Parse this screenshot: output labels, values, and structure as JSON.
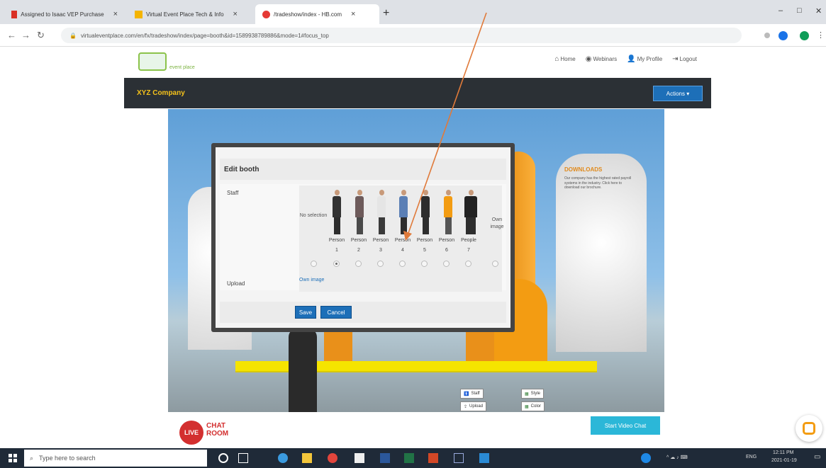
{
  "browser": {
    "tabs": [
      {
        "title": "Assigned to Isaac VEP Purchase",
        "favicon_color": "#d93025"
      },
      {
        "title": "Virtual Event Place Tech & Info",
        "favicon_color": "#f4b400"
      },
      {
        "title": "/tradeshow/index - HB.com",
        "favicon_color": "#e53935",
        "active": true
      }
    ],
    "url": "virtualeventplace.com/en/fx/tradeshow/index/page=booth&id=1589938789886&mode=1#focus_top"
  },
  "site": {
    "nav": [
      {
        "label": "Home",
        "icon": "home-icon"
      },
      {
        "label": "Webinars",
        "icon": "webinar-icon"
      },
      {
        "label": "My Profile",
        "icon": "profile-icon"
      },
      {
        "label": "Logout",
        "icon": "logout-icon"
      }
    ],
    "logo_text": "event place",
    "company": "XYZ Company",
    "actions_label": "Actions"
  },
  "booth": {
    "downloads_title": "DOWNLOADS",
    "downloads_text": "Our company has the highest rated payroll systems in the industry. Click here to download our brochure.",
    "kiosk_buttons": [
      "Staff",
      "Style",
      "Upload",
      "Color"
    ],
    "chat_label_1": "CHAT",
    "chat_label_2": "ROOM",
    "live_label": "LIVE",
    "video_chat_label": "Start Video Chat"
  },
  "dialog": {
    "title": "Edit booth",
    "staff_label": "Staff",
    "no_selection": "No selection",
    "own_image": "Own image",
    "options": [
      {
        "name": "Person",
        "num": "1"
      },
      {
        "name": "Person",
        "num": "2"
      },
      {
        "name": "Person",
        "num": "3"
      },
      {
        "name": "Person",
        "num": "4"
      },
      {
        "name": "Person",
        "num": "5"
      },
      {
        "name": "Person",
        "num": "6"
      },
      {
        "name": "People",
        "num": "7"
      }
    ],
    "selected_index": 1,
    "upload_label": "Upload",
    "upload_link": "Own image",
    "save_label": "Save",
    "cancel_label": "Cancel"
  },
  "taskbar": {
    "search_placeholder": "Type here to search",
    "tray_lang": "ENG",
    "time": "12:11 PM",
    "date": "2021-01-19"
  },
  "colors": {
    "accent": "#1d6fb8",
    "annotation_arrow": "#e07a3a",
    "company_text": "#f5c21b"
  }
}
